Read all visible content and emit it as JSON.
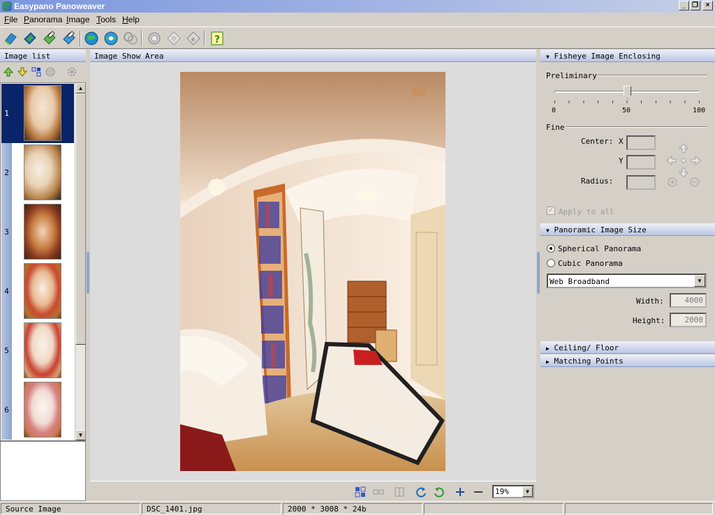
{
  "window": {
    "title": "Easypano Panoweaver"
  },
  "menu": [
    "File",
    "Panorama",
    "Image",
    "Tools",
    "Help"
  ],
  "toolbar": {
    "icons": [
      "new-project-icon",
      "open-project-icon",
      "save-project-icon",
      "save-as-icon",
      "stitch-icon",
      "publish-icon",
      "batch-icon",
      "preview-icon",
      "edit-icon",
      "hotspot-icon",
      "help-icon"
    ]
  },
  "left_panel": {
    "header": "Image list",
    "tools": [
      "move-up-icon",
      "move-down-icon",
      "auto-arrange-icon",
      "rotate-icon",
      "settings-icon"
    ],
    "items": [
      {
        "num": "1",
        "selected": true
      },
      {
        "num": "2",
        "selected": false
      },
      {
        "num": "3",
        "selected": false
      },
      {
        "num": "4",
        "selected": false
      },
      {
        "num": "5",
        "selected": false
      },
      {
        "num": "6",
        "selected": false
      }
    ]
  },
  "center": {
    "header": "Image Show Area",
    "zoom": "19%",
    "tools": [
      "fit-icon",
      "actual-size-icon",
      "split-icon",
      "rotate-left-icon",
      "rotate-right-icon",
      "zoom-in-icon",
      "zoom-out-icon"
    ]
  },
  "right_panel": {
    "fisheye": {
      "header": "Fisheye Image Enclosing",
      "preliminary": "Preliminary",
      "slider": {
        "min": "0",
        "mid": "50",
        "max": "100",
        "value": 50
      },
      "fine": "Fine",
      "center_label": "Center:",
      "x_label": "X",
      "y_label": "Y",
      "radius_label": "Radius:",
      "apply_all": "Apply to all"
    },
    "size": {
      "header": "Panoramic Image Size",
      "spherical": "Spherical Panorama",
      "cubic": "Cubic Panorama",
      "preset": "Web Broadband",
      "width_label": "Width:",
      "width_value": "4000",
      "height_label": "Height:",
      "height_value": "2000"
    },
    "ceiling": "Ceiling/ Floor",
    "matching": "Matching Points"
  },
  "status": {
    "source": "Source Image",
    "filename": "DSC_1401.jpg",
    "info": "2000 * 3008 * 24b"
  },
  "colors": {
    "header_blue": "#b9c6e3",
    "selection": "#0a246a"
  }
}
